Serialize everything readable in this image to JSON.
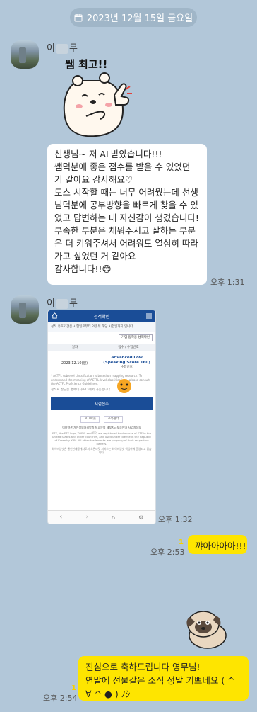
{
  "date_divider": "2023년 12월 15일 금요일",
  "sender_name_prefix": "이",
  "sender_name_suffix": "무",
  "sticker1_text": "쌤 최고!!",
  "message1": "선생님~ 저 AL받았습니다!!!\n쌤덕분에 좋은 점수를 받을 수 있었던 거 같아요 감사해요♡\n토스 시작할 때는 너무 어려웠는데 선생님덕분에 공부방향을 빠르게 찾을 수 있었고 답변하는 데 자신감이 생겼습니다!\n부족한 부분은 채워주시고 잘하는 부분은 더 키워주셔서 어려워도 열심히 따라가고 싶었던 거 같아요\n감사합니다!!😊",
  "time1": "오후 1:31",
  "time2": "오후 1:32",
  "screenshot": {
    "header": "성적확인",
    "notice": "성적 유효기간은 시험일로부터 2년 뒤 해당 시험일까지 입니다.",
    "button_top": "기업 입학용 성적확인",
    "col1": "일자",
    "col2": "점수 / 수험번호",
    "date": "2023.12.10(일)",
    "score": "Advanced Low (Speaking Score 160)",
    "exam_no": "수험번호",
    "note1": "* ACTFL sublevel classification is based on mapping research. To understand the meaning of ACTFL level classifications, please consult the ACTFL Proficiency Guidelines.",
    "note2": "성적표 발급은 홈페이지(PC)에서 가능합니다.",
    "main_button": "시험접수",
    "link1": "로그아웃",
    "link2": "고객센터",
    "footer1": "이용약관  개인정보처리방침  제휴문의  제부지급보증안내  사업자정보",
    "footer2": "ETS, the ETS logo, TOEIC and 토익 are registered trademarks of ETS in the United States and other countries, and used under license in the Republic of Korea by YBM. All other trademarks are property of their respective owners.",
    "footer3": "와이비엠넷은 통신판매중개자로서 오픈마켓 서비스는 와이비엠넷 책임하에 운영되고 있습니다."
  },
  "my_msg1": "꺄아아아아!!!",
  "my_time1": "오후 2:53",
  "unread1": "1",
  "my_msg2": "진심으로 축하드립니다 영무님!\n연말에 선물같은 소식 정말 기쁘네요 ( ^ ∀ ^ ● ) ﾉｼ",
  "my_time2": "오후 2:54",
  "unread2": "1",
  "colors": {
    "background": "#b2c7d9",
    "my_bubble": "#fee500",
    "their_bubble": "#ffffff"
  }
}
